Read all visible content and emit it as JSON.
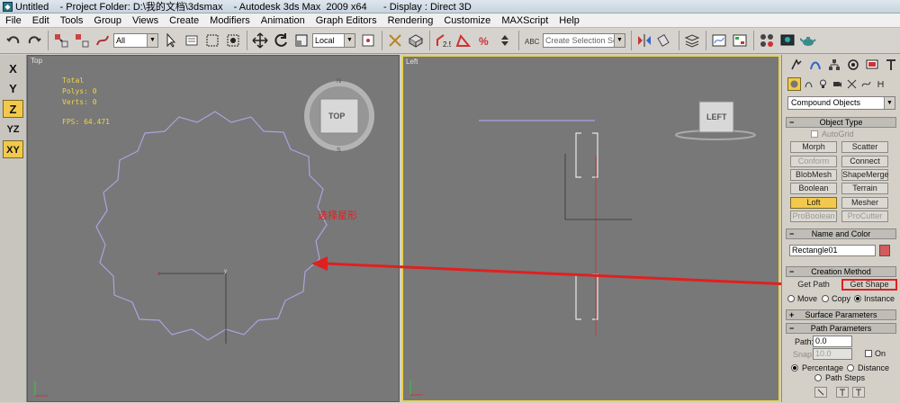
{
  "window": {
    "title": "Untitled    - Project Folder: D:\\我的文档\\3dsmax    - Autodesk 3ds Max  2009 x64      - Display : Direct 3D"
  },
  "menu": [
    "File",
    "Edit",
    "Tools",
    "Group",
    "Views",
    "Create",
    "Modifiers",
    "Animation",
    "Graph Editors",
    "Rendering",
    "Customize",
    "MAXScript",
    "Help"
  ],
  "toolbar": {
    "selection_filter": "All",
    "reference_coord": "Local",
    "named_selection_placeholder": "Create Selection Set"
  },
  "axis_constraints": {
    "x": "X",
    "y": "Y",
    "z": "Z",
    "yz": "YZ",
    "xy": "XY"
  },
  "viewports": {
    "top": {
      "label": "Top",
      "stats": {
        "total": "Total",
        "polys": "Polys: 0",
        "verts": "Verts: 0",
        "fps": "FPS:   64.471"
      },
      "viewcube": "TOP",
      "annotation": "选择星形"
    },
    "left": {
      "label": "Left",
      "viewcube": "LEFT"
    }
  },
  "command_panel": {
    "category": "Compound Objects",
    "object_type": {
      "header": "Object Type",
      "autogrid": "AutoGrid",
      "buttons": [
        {
          "label": "Morph",
          "state": "normal"
        },
        {
          "label": "Scatter",
          "state": "normal"
        },
        {
          "label": "Conform",
          "state": "disabled"
        },
        {
          "label": "Connect",
          "state": "normal"
        },
        {
          "label": "BlobMesh",
          "state": "normal"
        },
        {
          "label": "ShapeMerge",
          "state": "normal"
        },
        {
          "label": "Boolean",
          "state": "normal"
        },
        {
          "label": "Terrain",
          "state": "normal"
        },
        {
          "label": "Loft",
          "state": "active"
        },
        {
          "label": "Mesher",
          "state": "normal"
        },
        {
          "label": "ProBoolean",
          "state": "disabled"
        },
        {
          "label": "ProCutter",
          "state": "disabled"
        }
      ]
    },
    "name_color": {
      "header": "Name and Color",
      "name": "Rectangle01",
      "color": "#d35c5c"
    },
    "creation_method": {
      "header": "Creation Method",
      "get_path": "Get Path",
      "get_shape": "Get Shape",
      "move": "Move",
      "copy": "Copy",
      "instance": "Instance"
    },
    "surface_parameters": {
      "header": "Surface Parameters"
    },
    "path_parameters": {
      "header": "Path Parameters",
      "path_label": "Path:",
      "path_value": "0.0",
      "snap_label": "Snap:",
      "snap_value": "10.0",
      "on_label": "On",
      "percentage": "Percentage",
      "distance": "Distance",
      "path_steps": "Path Steps"
    }
  },
  "colors": {
    "viewport_bg": "#787878",
    "active_viewport_border": "#e7d34b",
    "highlight": "#e02020",
    "active_button": "#f2c94c",
    "shape_line": "#a9a4e0"
  }
}
